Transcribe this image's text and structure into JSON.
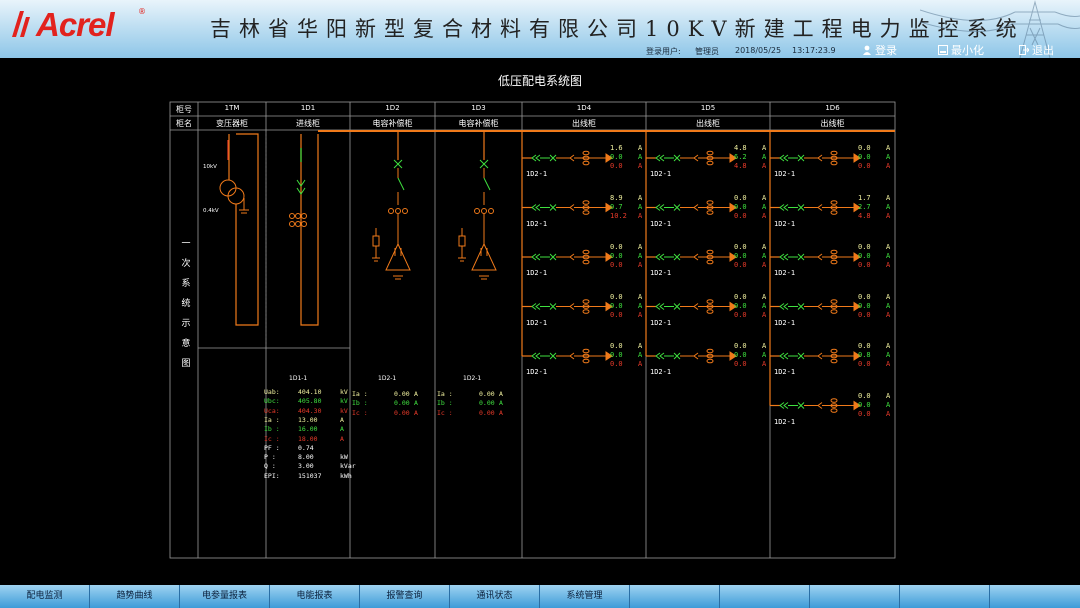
{
  "header": {
    "brand": "Acrel",
    "brand_reg": "®",
    "title": "吉林省华阳新型复合材料有限公司10KV新建工程电力监控系统",
    "user_label": "登录用户:",
    "user_name": "管理员",
    "date": "2018/05/25",
    "time": "13:17:23.9",
    "login_label": "登录",
    "minimize_label": "最小化",
    "exit_label": "退出"
  },
  "diagram": {
    "title": "低压配电系统图",
    "row_label_cabinet_no": "柜号",
    "row_label_cabinet_name": "柜名",
    "side_label": [
      "一",
      "次",
      "系",
      "统",
      "示",
      "意",
      "图"
    ],
    "cabinets": [
      {
        "no": "1TM",
        "name": "变压器柜"
      },
      {
        "no": "1D1",
        "name": "进线柜"
      },
      {
        "no": "1D2",
        "name": "电容补偿柜"
      },
      {
        "no": "1D3",
        "name": "电容补偿柜"
      },
      {
        "no": "1D4",
        "name": "出线柜"
      },
      {
        "no": "1D5",
        "name": "出线柜"
      },
      {
        "no": "1D6",
        "name": "出线柜"
      }
    ],
    "transformer": {
      "hv": "10kV",
      "lv": "0.4kV"
    },
    "feeder_circuit_label": "1D2-1",
    "feeder_circuit_label_alt": "1D2-1",
    "unit_a": "A",
    "feeders": {
      "1D4": [
        [
          "1.6",
          "0.0",
          "0.0"
        ],
        [
          "8.9",
          "0.7",
          "10.2"
        ],
        [
          "0.0",
          "0.0",
          "0.0"
        ],
        [
          "0.0",
          "0.0",
          "0.0"
        ],
        [
          "0.0",
          "0.0",
          "0.0"
        ]
      ],
      "1D5": [
        [
          "4.8",
          "6.2",
          "4.8"
        ],
        [
          "0.0",
          "0.0",
          "0.0"
        ],
        [
          "0.0",
          "0.0",
          "0.0"
        ],
        [
          "0.0",
          "0.0",
          "0.0"
        ],
        [
          "0.0",
          "0.0",
          "0.0"
        ]
      ],
      "1D6": [
        [
          "0.0",
          "0.0",
          "0.0"
        ],
        [
          "1.7",
          "2.7",
          "4.8"
        ],
        [
          "0.0",
          "0.0",
          "0.0"
        ],
        [
          "0.0",
          "0.0",
          "0.0"
        ],
        [
          "0.0",
          "0.8",
          "0.0"
        ],
        [
          "0.0",
          "0.0",
          "0.0"
        ]
      ]
    },
    "incoming": {
      "id": "1D1-1",
      "rows": [
        {
          "k": "Uab:",
          "v": "404.10",
          "u": "kV",
          "c": "y"
        },
        {
          "k": "Ubc:",
          "v": "405.80",
          "u": "kV",
          "c": "g"
        },
        {
          "k": "Uca:",
          "v": "404.30",
          "u": "kV",
          "c": "r"
        },
        {
          "k": "Ia :",
          "v": "13.00",
          "u": "A",
          "c": "y"
        },
        {
          "k": "Ib :",
          "v": "16.00",
          "u": "A",
          "c": "g"
        },
        {
          "k": "Ic :",
          "v": "18.00",
          "u": "A",
          "c": "r"
        },
        {
          "k": "PF :",
          "v": "0.74",
          "u": "",
          "c": "w"
        },
        {
          "k": "P  :",
          "v": "8.00",
          "u": "kW",
          "c": "w"
        },
        {
          "k": "Q  :",
          "v": "3.00",
          "u": "kVar",
          "c": "w"
        },
        {
          "k": "EPI:",
          "v": "151037",
          "u": "kWh",
          "c": "w"
        }
      ]
    },
    "capacitors": [
      {
        "id": "1D2-1",
        "rows": [
          {
            "k": "Ia :",
            "v": "0.00",
            "u": "A",
            "c": "y"
          },
          {
            "k": "Ib :",
            "v": "0.00",
            "u": "A",
            "c": "g"
          },
          {
            "k": "Ic :",
            "v": "0.00",
            "u": "A",
            "c": "r"
          }
        ]
      },
      {
        "id": "1D2-1",
        "rows": [
          {
            "k": "Ia :",
            "v": "0.00",
            "u": "A",
            "c": "y"
          },
          {
            "k": "Ib :",
            "v": "0.00",
            "u": "A",
            "c": "g"
          },
          {
            "k": "Ic :",
            "v": "0.00",
            "u": "A",
            "c": "r"
          }
        ]
      }
    ]
  },
  "nav": [
    "配电监测",
    "趋势曲线",
    "电参量报表",
    "电能报表",
    "报警查询",
    "通讯状态",
    "系统管理",
    "",
    "",
    "",
    "",
    ""
  ],
  "colors": {
    "bus": "#f07a1a",
    "phase_a": "#f2f2a0",
    "phase_b": "#3fe03f",
    "phase_c": "#e83a2a",
    "grid": "#9a9a9a"
  }
}
